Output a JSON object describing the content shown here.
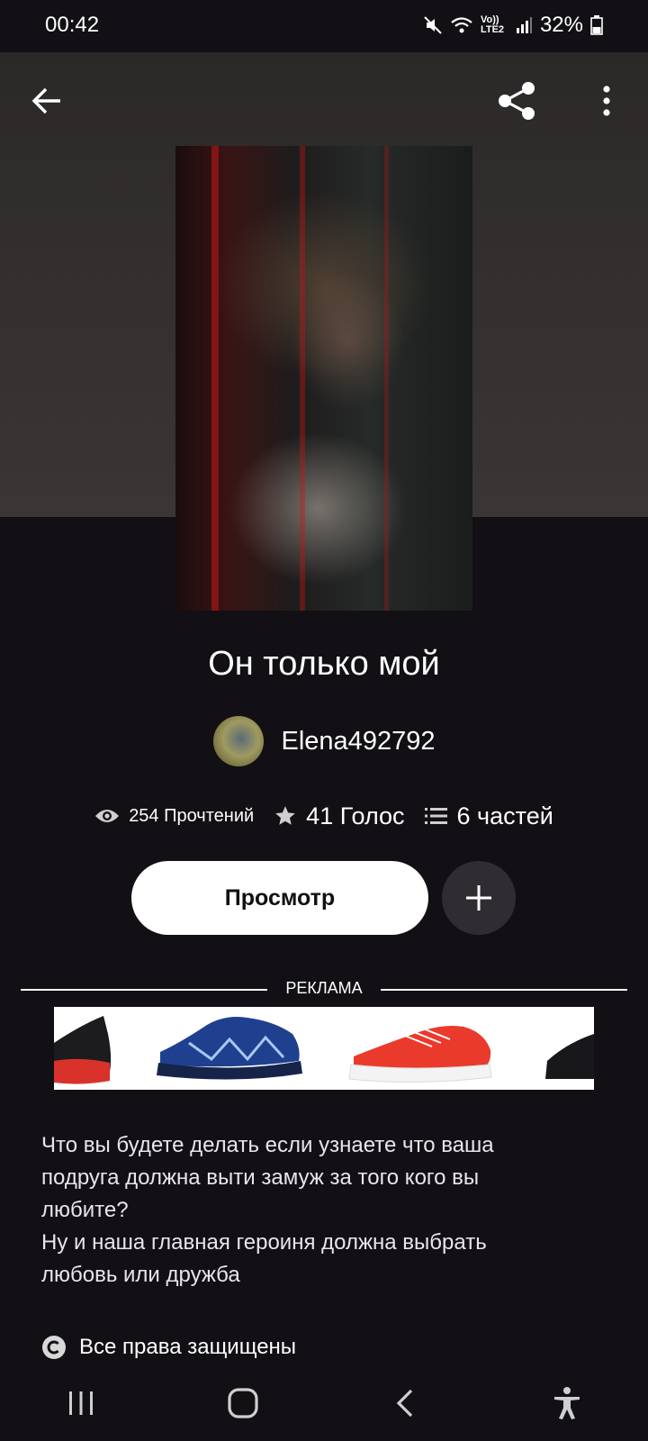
{
  "status_bar": {
    "time": "00:42",
    "network": "Vo)) LTE2",
    "battery": "32%"
  },
  "app_bar": {
    "back_icon": "arrow-left-icon",
    "share_icon": "share-icon",
    "more_icon": "more-vertical-icon"
  },
  "story": {
    "title": "Он только мой",
    "author": "Elena492792",
    "stats": {
      "reads": "254 Прочтений",
      "votes": "41 Голос",
      "parts": "6 частей"
    },
    "read_button": "Просмотр",
    "add_button_icon": "plus-icon",
    "description": [
      "Что вы будете делать если узнаете что ваша",
      "подруга должна выти замуж за того кого вы",
      "любите?",
      "Ну и наша главная героиня должна выбрать",
      "любовь или дружба"
    ],
    "copyright": "Все права защищены"
  },
  "ad": {
    "label": "РЕКЛАМА"
  },
  "colors": {
    "background": "#121014",
    "hero": "#333030",
    "button_bg": "#ffffff",
    "button_text": "#121014",
    "add_button_bg": "#2f2d31"
  },
  "nav_bar": {
    "recents_icon": "recents-icon",
    "home_icon": "home-icon",
    "back_icon": "chevron-left-icon",
    "accessibility_icon": "accessibility-icon"
  }
}
